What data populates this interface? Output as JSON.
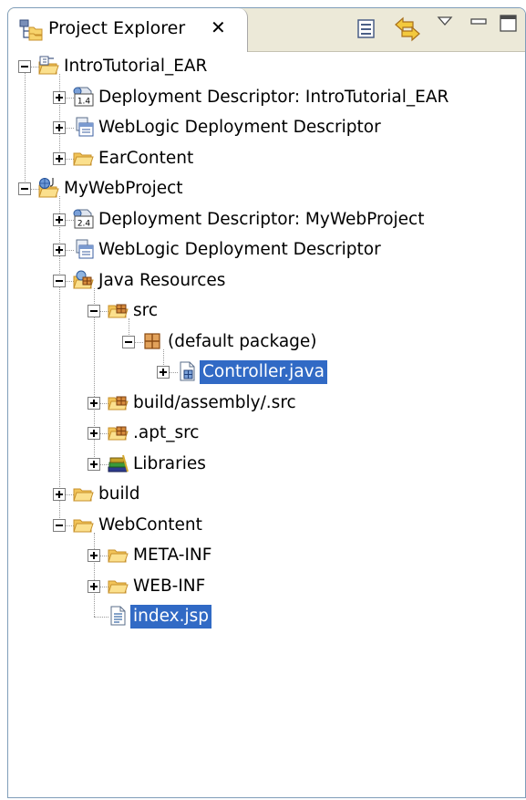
{
  "view": {
    "title": "Project Explorer",
    "close_glyph": "✕",
    "toolbar": [
      {
        "name": "collapse-all-icon"
      },
      {
        "name": "link-with-editor-icon"
      },
      {
        "name": "view-menu-icon"
      },
      {
        "name": "minimize-icon"
      },
      {
        "name": "maximize-icon"
      }
    ]
  },
  "tree": [
    {
      "label": "IntroTutorial_EAR",
      "level": 0,
      "icon": "ear-project-icon",
      "expander": "minus"
    },
    {
      "label": "Deployment Descriptor: IntroTutorial_EAR",
      "level": 1,
      "icon": "deployment-descriptor-icon",
      "badge": "1.4",
      "expander": "plus"
    },
    {
      "label": "WebLogic Deployment Descriptor",
      "level": 1,
      "icon": "weblogic-descriptor-icon",
      "expander": "plus"
    },
    {
      "label": "EarContent",
      "level": 1,
      "icon": "folder-icon",
      "expander": "plus"
    },
    {
      "label": "MyWebProject",
      "level": 0,
      "icon": "web-project-icon",
      "expander": "minus"
    },
    {
      "label": "Deployment Descriptor: MyWebProject",
      "level": 1,
      "icon": "deployment-descriptor-icon",
      "badge": "2.4",
      "expander": "plus"
    },
    {
      "label": "WebLogic Deployment Descriptor",
      "level": 1,
      "icon": "weblogic-descriptor-icon",
      "expander": "plus"
    },
    {
      "label": "Java Resources",
      "level": 1,
      "icon": "java-resources-icon",
      "expander": "minus"
    },
    {
      "label": "src",
      "level": 2,
      "icon": "source-folder-icon",
      "expander": "minus"
    },
    {
      "label": "(default package)",
      "level": 3,
      "icon": "package-icon",
      "expander": "minus"
    },
    {
      "label": "Controller.java",
      "level": 4,
      "icon": "java-file-icon",
      "expander": "plus",
      "selected": true
    },
    {
      "label": "build/assembly/.src",
      "level": 2,
      "icon": "source-folder-icon",
      "expander": "plus"
    },
    {
      "label": ".apt_src",
      "level": 2,
      "icon": "source-folder-icon",
      "expander": "plus"
    },
    {
      "label": "Libraries",
      "level": 2,
      "icon": "libraries-icon",
      "expander": "plus"
    },
    {
      "label": "build",
      "level": 1,
      "icon": "folder-icon",
      "expander": "plus"
    },
    {
      "label": "WebContent",
      "level": 1,
      "icon": "folder-icon",
      "expander": "minus"
    },
    {
      "label": "META-INF",
      "level": 2,
      "icon": "folder-icon",
      "expander": "plus"
    },
    {
      "label": "WEB-INF",
      "level": 2,
      "icon": "folder-icon",
      "expander": "plus"
    },
    {
      "label": "index.jsp",
      "level": 2,
      "icon": "jsp-file-icon",
      "expander": "none",
      "selected": true
    }
  ],
  "colors": {
    "selection": "#316ac5",
    "folder": "#f7d36b",
    "folder_border": "#c7902b",
    "package": "#b45a10",
    "tab_bar": "#ece9d8"
  }
}
